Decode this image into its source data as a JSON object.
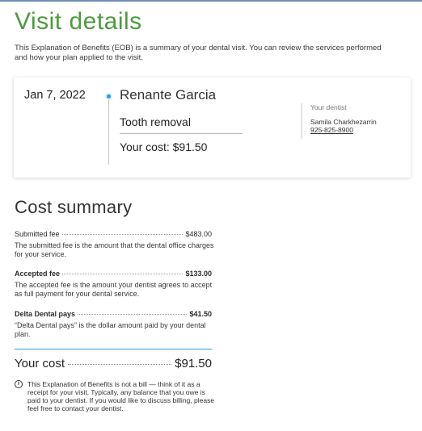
{
  "page": {
    "title": "Visit details",
    "intro": "This Explanation of Benefits (EOB) is a summary of your dental visit. You can review the services performed and how your plan applied to the visit."
  },
  "visit": {
    "date": "Jan 7, 2022",
    "patient": "Renante Garcia",
    "service": "Tooth removal",
    "cost": "Your cost: $91.50",
    "dentist_label": "Your dentist",
    "dentist_name": "Samila Charkhezarrin",
    "dentist_phone": "925-825-8900"
  },
  "summary": {
    "title": "Cost summary",
    "rows": [
      {
        "label": "Submitted fee",
        "amount": "$483.00",
        "desc": "The submitted fee is the amount that the dental office charges for your service."
      },
      {
        "label": "Accepted fee",
        "amount": "$133.00",
        "desc": "The accepted fee is the amount your dentist agrees to accept as full payment for your dental service."
      },
      {
        "label": "Delta Dental pays",
        "amount": "$41.50",
        "desc": "“Delta Dental pays” is the dollar amount paid by your dental plan."
      }
    ],
    "total_label": "Your cost",
    "total_amount": "$91.50",
    "notice_icon": "info-icon",
    "notice": "This Explanation of Benefits is not a bill — think of it as a receipt for your visit. Typically, any balance that you owe is paid to your dentist. If you would like to discuss billing, please feel free to contact your dentist."
  },
  "colors": {
    "title_green": "#4e9a3f",
    "accent_blue": "#2a9fd8"
  }
}
